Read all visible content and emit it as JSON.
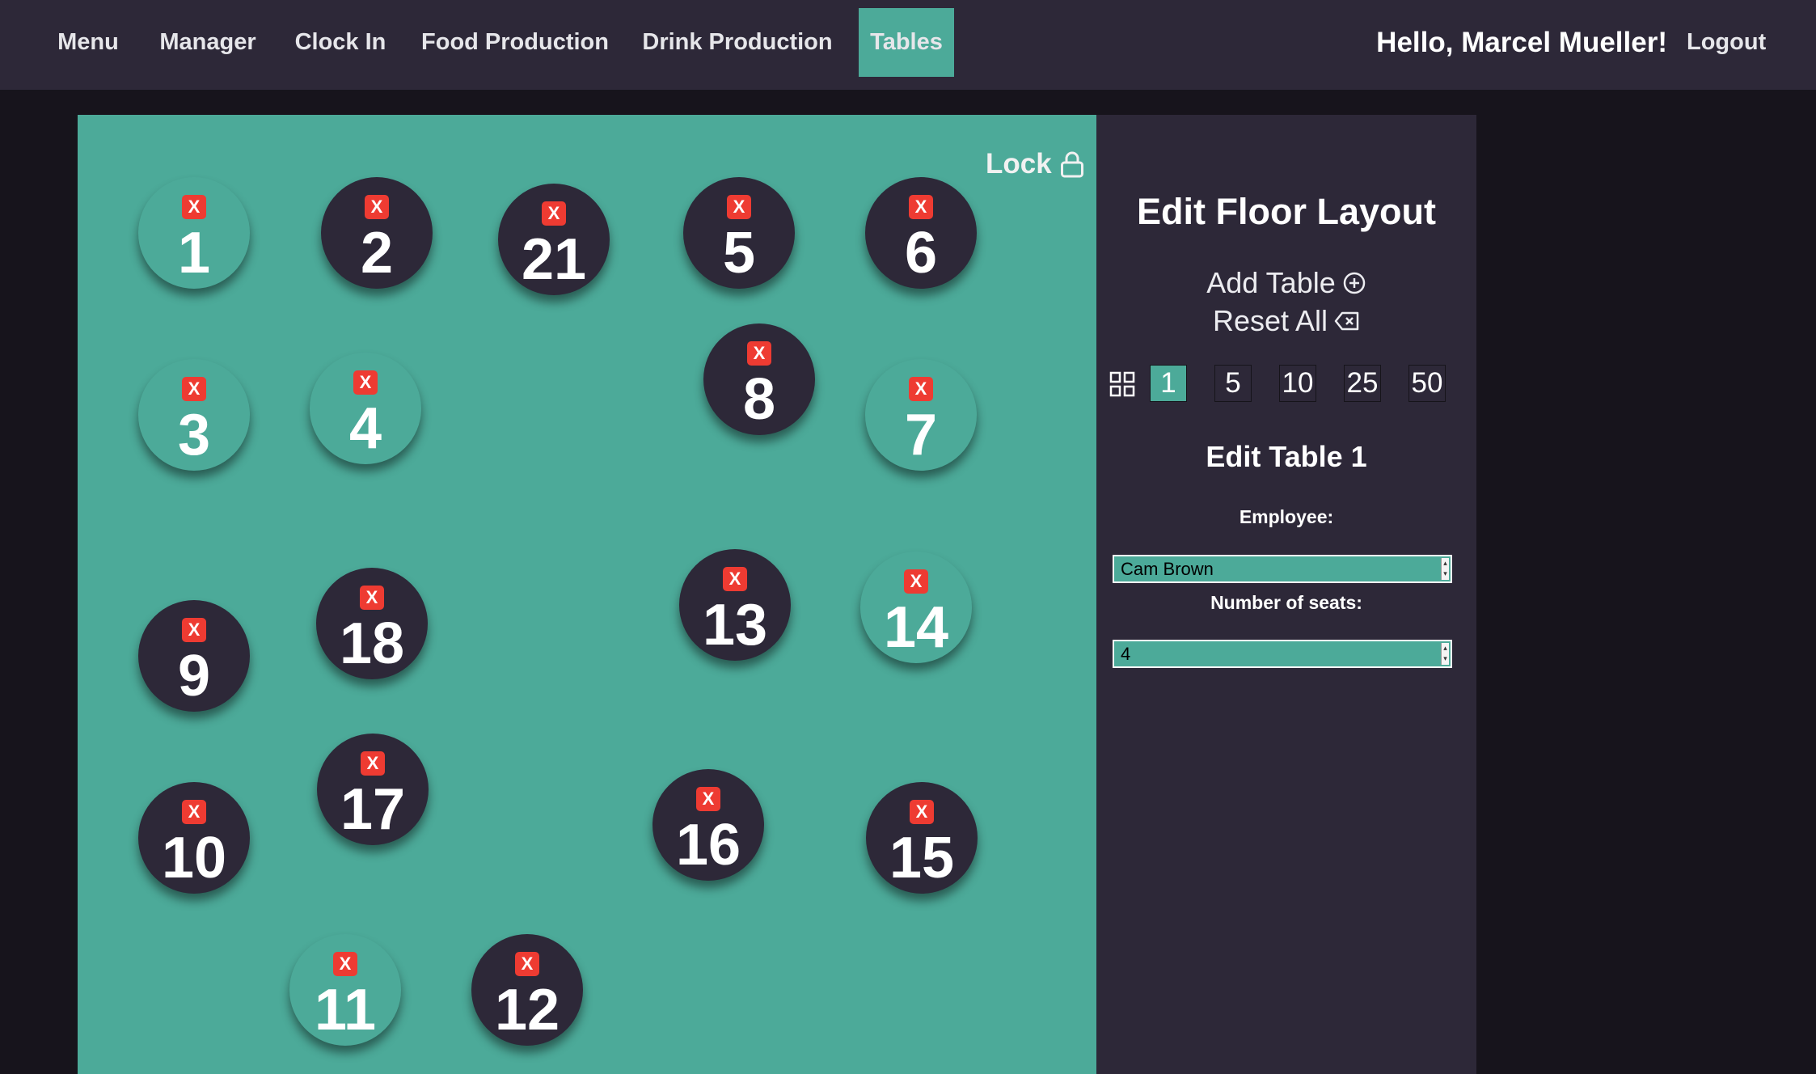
{
  "nav": {
    "items": [
      "Menu",
      "Manager",
      "Clock In",
      "Food Production",
      "Drink Production",
      "Tables"
    ],
    "active": "Tables",
    "greeting": "Hello, Marcel Mueller!",
    "logout": "Logout"
  },
  "floor": {
    "lock_label": "Lock",
    "lock_icon": "lock-icon",
    "delete_label": "X",
    "tables": [
      {
        "number": "1",
        "color": "teal"
      },
      {
        "number": "2",
        "color": "dark"
      },
      {
        "number": "21",
        "color": "dark"
      },
      {
        "number": "5",
        "color": "dark"
      },
      {
        "number": "6",
        "color": "dark"
      },
      {
        "number": "3",
        "color": "teal"
      },
      {
        "number": "4",
        "color": "teal"
      },
      {
        "number": "8",
        "color": "dark"
      },
      {
        "number": "7",
        "color": "teal"
      },
      {
        "number": "9",
        "color": "dark"
      },
      {
        "number": "18",
        "color": "dark"
      },
      {
        "number": "13",
        "color": "dark"
      },
      {
        "number": "14",
        "color": "teal"
      },
      {
        "number": "10",
        "color": "dark"
      },
      {
        "number": "17",
        "color": "dark"
      },
      {
        "number": "16",
        "color": "dark"
      },
      {
        "number": "15",
        "color": "dark"
      },
      {
        "number": "11",
        "color": "teal"
      },
      {
        "number": "12",
        "color": "dark"
      }
    ]
  },
  "panel": {
    "title": "Edit Floor Layout",
    "add_table": "Add Table",
    "add_icon": "plus-circle-icon",
    "reset_all": "Reset All",
    "reset_icon": "backspace-icon",
    "grid_icon": "grid-icon",
    "grid_sizes": [
      "1",
      "5",
      "10",
      "25",
      "50"
    ],
    "grid_active": "1",
    "edit_title": "Edit Table 1",
    "employee_label": "Employee:",
    "employee_value": "Cam Brown",
    "seats_label": "Number of seats:",
    "seats_value": "4"
  },
  "colors": {
    "teal": "#4caa99",
    "dark": "#2d2838",
    "background": "#17141c",
    "delete_red": "#ee3b32"
  }
}
